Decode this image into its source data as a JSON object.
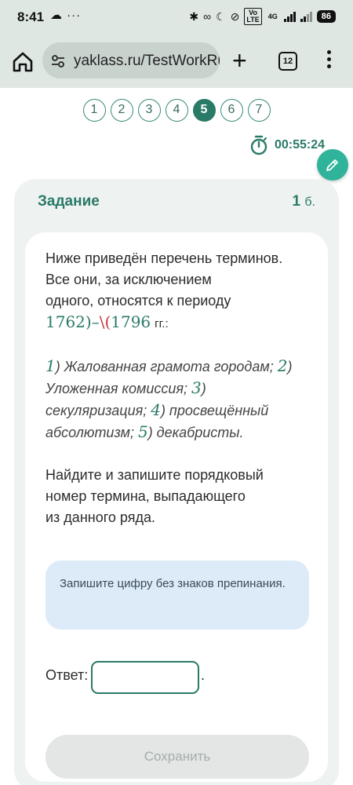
{
  "status_bar": {
    "time": "8:41",
    "left_icons": "☁ ···",
    "network": "4G",
    "battery": "86"
  },
  "browser": {
    "url": "yaklass.ru/TestWorkRun",
    "tab_count": "12"
  },
  "pager": {
    "pages": [
      "1",
      "2",
      "3",
      "4",
      "5",
      "6",
      "7"
    ],
    "active": "5"
  },
  "timer": "00:55:24",
  "task": {
    "header": "Задание",
    "points_value": "1",
    "points_unit": "б.",
    "question_line1": "Ниже приведён перечень терминов.",
    "question_line2": "Все они, за исключением",
    "question_line3": "одного, относятся к периоду",
    "period_start": "1762)",
    "period_dash": "–",
    "period_escape": "\\(",
    "period_end": "1796",
    "period_suffix": "гг.:",
    "terms": [
      {
        "num": "1",
        "text": ") Жалованная грамота городам; "
      },
      {
        "num": "2",
        "text": ")"
      },
      {
        "num": "",
        "text": "Уложенная комиссия; "
      },
      {
        "num": "3",
        "text": ")"
      },
      {
        "num": "",
        "text": "секуляризация; "
      },
      {
        "num": "4",
        "text": ") просвещённый"
      },
      {
        "num": "",
        "text": "абсолютизм; "
      },
      {
        "num": "5",
        "text": ") декабристы."
      }
    ],
    "instruction_line1": "Найдите и запишите порядковый",
    "instruction_line2": "номер термина, выпадающего",
    "instruction_line3": "из данного ряда.",
    "hint": "Запишите цифру без знаков препинания.",
    "answer_label": "Ответ:",
    "answer_suffix": ".",
    "answer_value": "",
    "save_label": "Сохранить"
  },
  "colors": {
    "accent": "#2a7a68",
    "browser_chrome": "#dfe7e3",
    "hint_bg": "#dcebf7",
    "fab": "#2fb39a"
  },
  "icons": [
    "home-icon",
    "site-settings-icon",
    "plus-icon",
    "tabs-icon",
    "more-vert-icon",
    "stopwatch-icon",
    "pencil-icon"
  ]
}
